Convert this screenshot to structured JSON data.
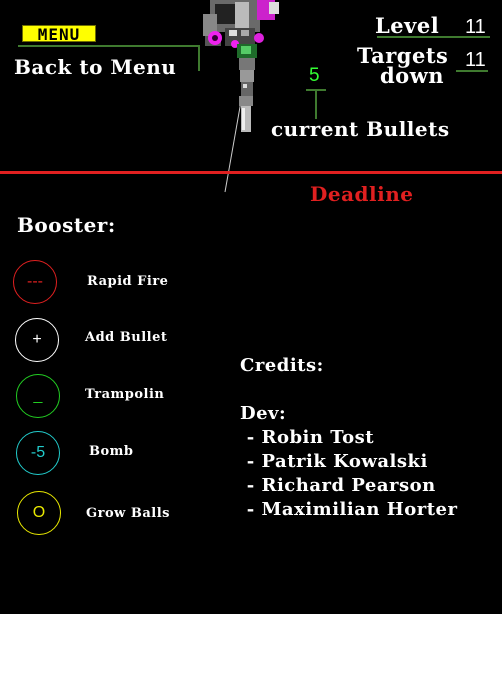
{
  "menu": {
    "badge_label": "MENU",
    "back_label": "Back to Menu"
  },
  "hud": {
    "level_label": "Level",
    "level_value": "11",
    "targets_label_line1": "Targets",
    "targets_label_line2": "down",
    "targets_value": "11",
    "bullets_value": "5",
    "bullets_label": "current Bullets",
    "deadline_label": "Deadline"
  },
  "boosters": {
    "title": "Booster:",
    "items": [
      {
        "symbol": "---",
        "label": "Rapid Fire",
        "color": "#e02020"
      },
      {
        "symbol": "+",
        "label": "Add Bullet",
        "color": "#ffffff"
      },
      {
        "symbol": "_",
        "label": "Trampolin",
        "color": "#22cc22"
      },
      {
        "symbol": "-5",
        "label": "Bomb",
        "color": "#22cccc"
      },
      {
        "symbol": "O",
        "label": "Grow Balls",
        "color": "#e8e800"
      }
    ]
  },
  "credits": {
    "title": "Credits:",
    "dev_label": "Dev:",
    "names": [
      " - Robin Tost",
      " - Patrik Kowalski",
      " - Richard Pearson",
      " - Maximilian Horter"
    ]
  },
  "colors": {
    "background": "#000000",
    "deadline": "#e02020",
    "connector": "#3f7a2f",
    "bullets_value": "#33ff33",
    "menu_badge": "#ffff00"
  },
  "icons": {
    "cannon": "cannon-turret-icon"
  }
}
